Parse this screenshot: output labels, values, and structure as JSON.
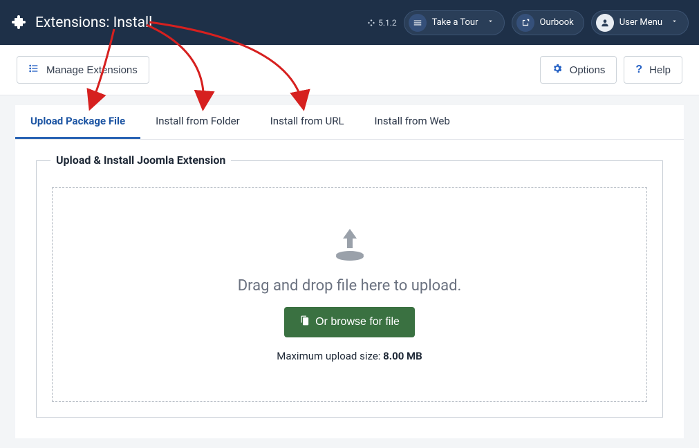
{
  "header": {
    "title": "Extensions: Install",
    "version": "5.1.2",
    "take_tour": "Take a Tour",
    "ourbook": "Ourbook",
    "user_menu": "User Menu"
  },
  "toolbar": {
    "manage_extensions": "Manage Extensions",
    "options": "Options",
    "help": "Help"
  },
  "tabs": [
    {
      "label": "Upload Package File"
    },
    {
      "label": "Install from Folder"
    },
    {
      "label": "Install from URL"
    },
    {
      "label": "Install from Web"
    }
  ],
  "upload": {
    "legend": "Upload & Install Joomla Extension",
    "drop_text": "Drag and drop file here to upload.",
    "browse_label": "Or browse for file",
    "max_size_label": "Maximum upload size: ",
    "max_size_value": "8.00 MB"
  }
}
